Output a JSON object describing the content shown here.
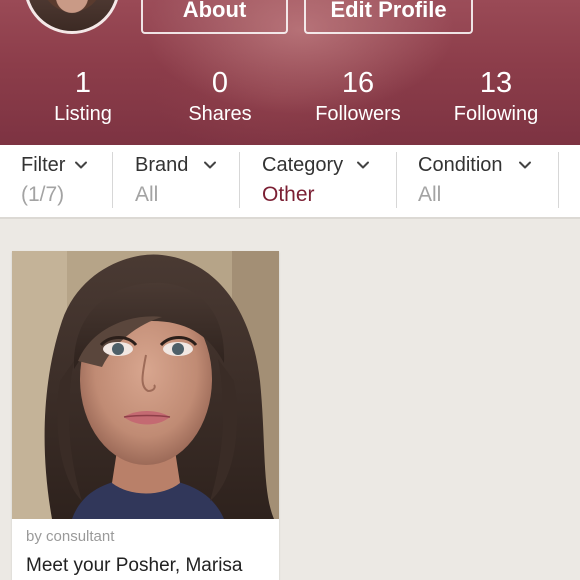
{
  "profile": {
    "about_label": "About",
    "edit_profile_label": "Edit Profile",
    "stats": {
      "listing": {
        "count": "1",
        "label": "Listing"
      },
      "shares": {
        "count": "0",
        "label": "Shares"
      },
      "followers": {
        "count": "16",
        "label": "Followers"
      },
      "following": {
        "count": "13",
        "label": "Following"
      }
    }
  },
  "filters": {
    "filter": {
      "label": "Filter",
      "value": "(1/7)"
    },
    "brand": {
      "label": "Brand",
      "value": "All"
    },
    "category": {
      "label": "Category",
      "value": "Other"
    },
    "condition": {
      "label": "Condition",
      "value": "All"
    }
  },
  "listings": [
    {
      "by": "by consultant",
      "title": "Meet your Posher, Marisa"
    }
  ],
  "colors": {
    "header_bg": "#8c3d4a",
    "accent": "#7b1f33",
    "muted_text": "#a3a3a3",
    "page_bg": "#ece9e4"
  },
  "icons": {
    "chevron": "chevron-down-icon"
  }
}
